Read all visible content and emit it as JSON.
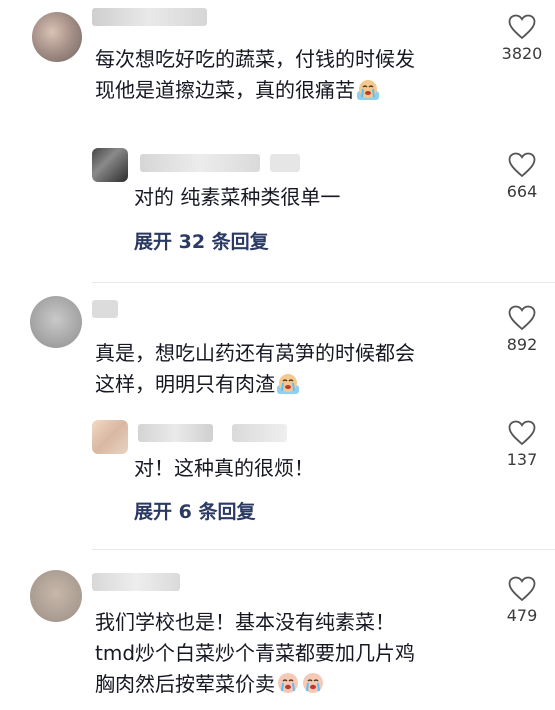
{
  "comments": [
    {
      "text_lines": [
        "每次想吃好吃的蔬菜，付钱的时候发",
        "现他是道擦边菜，真的很痛苦"
      ],
      "emoji": "crying-face",
      "likes": "3820",
      "reply": {
        "text": "对的 纯素菜种类很单一",
        "likes": "664"
      },
      "expand_label": "展开 32 条回复"
    },
    {
      "text_lines": [
        "真是，想吃山药还有莴笋的时候都会",
        "这样，明明只有肉渣"
      ],
      "emoji": "crying-face",
      "likes": "892",
      "reply": {
        "text": "对！这种真的很烦！",
        "likes": "137"
      },
      "expand_label": "展开 6 条回复"
    },
    {
      "text_lines": [
        "我们学校也是！基本没有纯素菜！",
        "tmd炒个白菜炒个青菜都要加几片鸡",
        "胸肉然后按荤菜价卖"
      ],
      "emoji": "crying-face",
      "likes": "479"
    }
  ],
  "colors": {
    "expand": "#2b3a63",
    "text": "#161823",
    "divider": "#e8e8e8"
  }
}
